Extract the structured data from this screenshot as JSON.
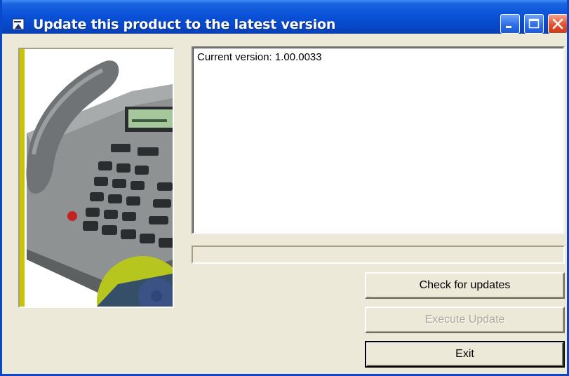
{
  "window": {
    "title": "Update this product to the latest version",
    "icon": "application-icon",
    "controls": [
      "minimize-icon",
      "maximize-icon",
      "close-icon"
    ]
  },
  "image": {
    "description_icon": "desk-phone-image"
  },
  "log": {
    "text": "Current version: 1.00.0033"
  },
  "progress": {
    "value_percent": 0
  },
  "buttons": {
    "check": "Check for updates",
    "execute": "Execute Update",
    "exit": "Exit"
  },
  "colors": {
    "titlebar": "#0a52d8",
    "face": "#ece9d8",
    "accent_stripe": "#c8c400",
    "disabled_text": "#aca899"
  }
}
